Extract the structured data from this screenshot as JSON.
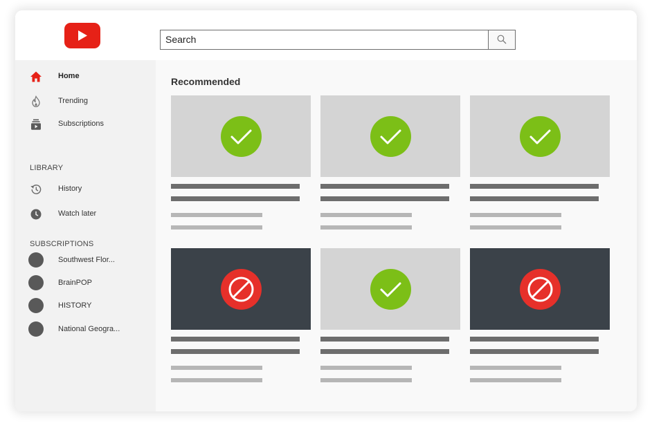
{
  "search": {
    "placeholder": "Search",
    "value": "Search"
  },
  "nav": [
    {
      "label": "Home",
      "icon": "home-icon",
      "active": true
    },
    {
      "label": "Trending",
      "icon": "flame-icon",
      "active": false
    },
    {
      "label": "Subscriptions",
      "icon": "subscriptions-icon",
      "active": false
    }
  ],
  "library": {
    "heading": "LIBRARY",
    "items": [
      {
        "label": "History",
        "icon": "history-icon"
      },
      {
        "label": "Watch later",
        "icon": "clock-icon"
      }
    ]
  },
  "subscriptions": {
    "heading": "SUBSCRIPTIONS",
    "items": [
      {
        "label": "Southwest Flor..."
      },
      {
        "label": "BrainPOP"
      },
      {
        "label": "HISTORY"
      },
      {
        "label": "National Geogra..."
      }
    ]
  },
  "main": {
    "title": "Recommended",
    "videos": [
      {
        "status": "approved",
        "icon": "checkmark-icon"
      },
      {
        "status": "approved",
        "icon": "checkmark-icon"
      },
      {
        "status": "approved",
        "icon": "checkmark-icon"
      },
      {
        "status": "blocked",
        "icon": "blocked-icon"
      },
      {
        "status": "approved",
        "icon": "checkmark-icon"
      },
      {
        "status": "blocked",
        "icon": "blocked-icon"
      }
    ]
  },
  "colors": {
    "brand_red": "#e62117",
    "approved_green": "#7cbf17",
    "blocked_red": "#e6302a",
    "blocked_thumb": "#3b4249",
    "approved_thumb": "#d4d4d4"
  }
}
